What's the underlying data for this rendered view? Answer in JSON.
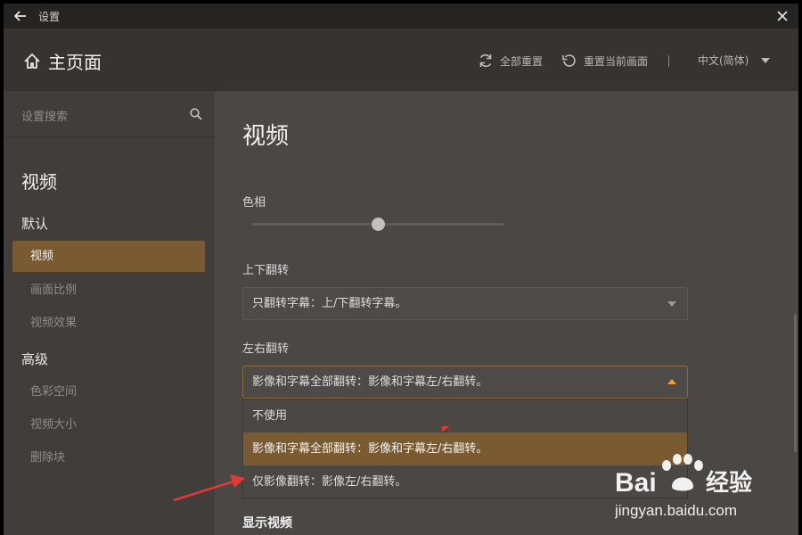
{
  "window": {
    "title": "设置",
    "back_icon": "arrow-left-icon",
    "close_icon": "close-icon"
  },
  "header": {
    "home_label": "主页面",
    "home_icon": "home-icon",
    "reset_all_label": "全部重置",
    "reset_current_label": "重置当前画面",
    "language": "中文(简体)"
  },
  "sidebar": {
    "search_placeholder": "设置搜索",
    "section_title": "视频",
    "groups": [
      {
        "label": "默认",
        "items": [
          "视频",
          "画面比例",
          "视频效果"
        ]
      },
      {
        "label": "高级",
        "items": [
          "色彩空间",
          "视频大小",
          "删除块"
        ]
      }
    ],
    "active_item": "视频"
  },
  "main": {
    "title": "视频",
    "hue": {
      "label": "色相",
      "value_fraction": 0.5
    },
    "vflip": {
      "label": "上下翻转",
      "value": "只翻转字幕：上/下翻转字幕。"
    },
    "hflip": {
      "label": "左右翻转",
      "value": "影像和字幕全部翻转：影像和字幕左/右翻转。",
      "options": [
        "不使用",
        "影像和字幕全部翻转：影像和字幕左/右翻转。",
        "仅影像翻转：影像左/右翻转。"
      ],
      "selected_index": 1
    },
    "next_section": "显示视频"
  },
  "colors": {
    "accent": "#7a5a30",
    "accent_arrow": "#f0a030",
    "annotation": "#e53935"
  },
  "watermark": {
    "brand_left": "Bai",
    "brand_right": "经验",
    "url": "jingyan.baidu.com"
  }
}
